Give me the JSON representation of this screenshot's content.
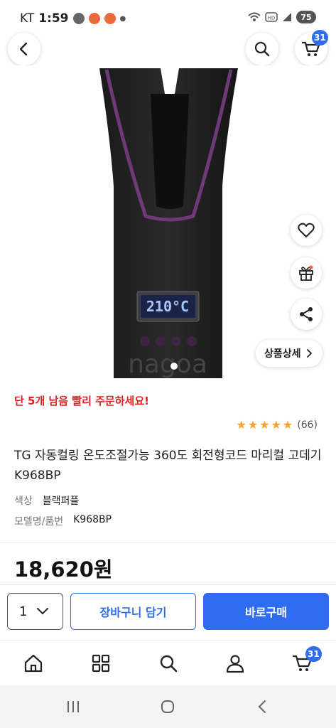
{
  "status_bar": {
    "carrier": "KT",
    "time": "1:59",
    "battery": "75"
  },
  "header": {
    "cart_count": "31"
  },
  "product_image": {
    "watermark": "nagoa",
    "display_reading": "210°C"
  },
  "side_buttons": {
    "detail_label": "상품상세"
  },
  "product": {
    "stock_warning": "단 5개 남음 빨리 주문하세요!",
    "rating_stars": 5,
    "review_count": "(66)",
    "title": "TG 자동컬링 온도조절가능 360도 회전형코드 마리컬 고데기 K968BP",
    "specs": [
      {
        "key": "색상",
        "value": "블랙퍼플"
      },
      {
        "key": "모델명/품번",
        "value": "K968BP"
      }
    ],
    "price": "18,620원"
  },
  "purchase_bar": {
    "quantity": "1",
    "cart_add_label": "장바구니 담기",
    "buy_now_label": "바로구매"
  },
  "bottom_nav": {
    "cart_count": "31"
  },
  "colors": {
    "accent": "#2f6cf0",
    "warning": "#e02020",
    "star": "#f3a32a"
  }
}
